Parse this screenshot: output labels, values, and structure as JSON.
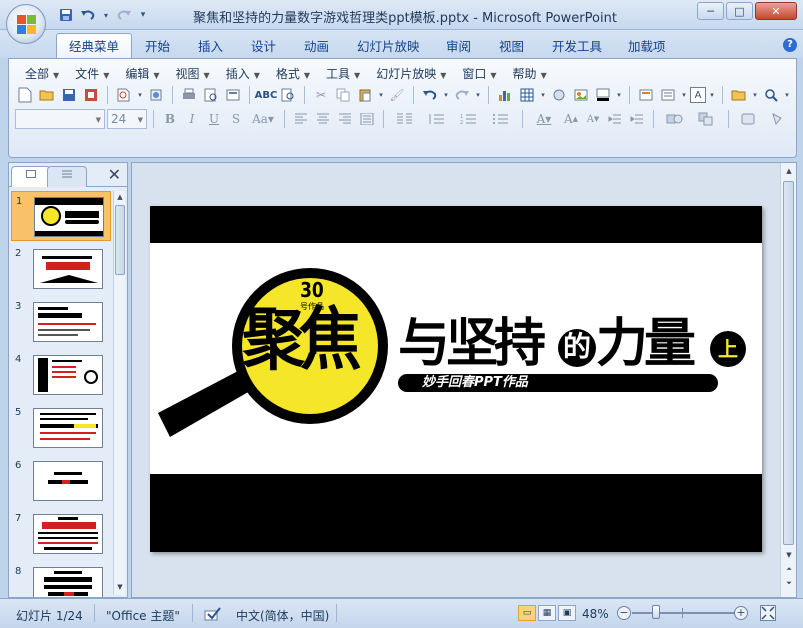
{
  "window": {
    "title": "聚焦和坚持的力量数字游戏哲理类ppt模板.pptx - Microsoft PowerPoint",
    "controls": {
      "minimize": "─",
      "maximize": "□",
      "close": "✕"
    }
  },
  "quick_access": [
    {
      "name": "save-icon",
      "glyph": "💾"
    },
    {
      "name": "undo-icon",
      "glyph": "↶"
    },
    {
      "name": "redo-icon",
      "glyph": "↷"
    },
    {
      "name": "customize-icon",
      "glyph": "▾"
    }
  ],
  "ribbon_tabs": [
    {
      "label": "经典菜单",
      "active": true
    },
    {
      "label": "开始"
    },
    {
      "label": "插入"
    },
    {
      "label": "设计"
    },
    {
      "label": "动画"
    },
    {
      "label": "幻灯片放映"
    },
    {
      "label": "审阅"
    },
    {
      "label": "视图"
    },
    {
      "label": "开发工具"
    },
    {
      "label": "加载项"
    }
  ],
  "menubar": [
    {
      "label": "全部"
    },
    {
      "label": "文件"
    },
    {
      "label": "编辑"
    },
    {
      "label": "视图"
    },
    {
      "label": "插入"
    },
    {
      "label": "格式"
    },
    {
      "label": "工具"
    },
    {
      "label": "幻灯片放映"
    },
    {
      "label": "窗口"
    },
    {
      "label": "帮助"
    }
  ],
  "format": {
    "font_name": "",
    "font_size": "24",
    "font_color_label": "A"
  },
  "thumbnails": [
    {
      "num": "1",
      "selected": true
    },
    {
      "num": "2"
    },
    {
      "num": "3"
    },
    {
      "num": "4"
    },
    {
      "num": "5"
    },
    {
      "num": "6"
    },
    {
      "num": "7"
    },
    {
      "num": "8"
    }
  ],
  "slide": {
    "badge_number": "30",
    "badge_sub": "号作品",
    "title_main": "聚焦",
    "title_rest_1": "与坚持",
    "title_rest_2": "的",
    "title_rest_3": "力量",
    "title_part": "上",
    "subtitle": "妙手回春PPT作品",
    "accent_color": "#f5e62a"
  },
  "status": {
    "slide_info": "幻灯片 1/24",
    "theme": "\"Office 主题\"",
    "language": "中文(简体，中国)",
    "zoom": "48%"
  }
}
